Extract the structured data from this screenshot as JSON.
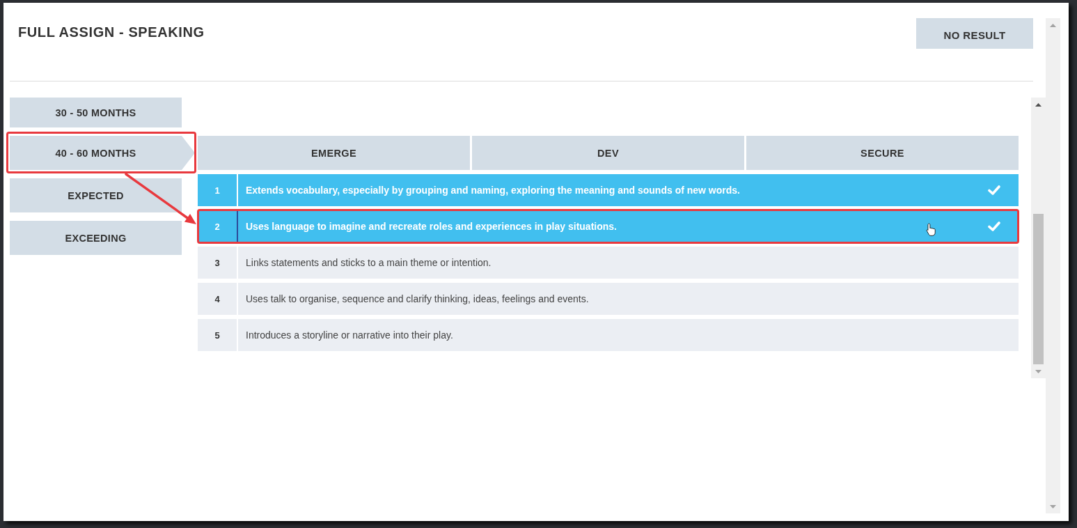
{
  "dialog": {
    "title": "FULL ASSIGN - SPEAKING",
    "action_button": "NO RESULT"
  },
  "tabs": [
    {
      "label": "30 - 50 MONTHS",
      "selected": false,
      "highlighted": false
    },
    {
      "label": "40 - 60 MONTHS",
      "selected": true,
      "highlighted": true
    },
    {
      "label": "EXPECTED",
      "selected": false,
      "highlighted": false
    },
    {
      "label": "EXCEEDING",
      "selected": false,
      "highlighted": false
    }
  ],
  "table": {
    "columns": [
      "EMERGE",
      "DEV",
      "SECURE"
    ],
    "rows": [
      {
        "number": "1",
        "text": "Extends vocabulary, especially by grouping and naming, exploring the meaning and sounds of new words.",
        "selected": true,
        "hovered": false,
        "highlighted": false
      },
      {
        "number": "2",
        "text": "Uses language to imagine and recreate roles and experiences in play situations.",
        "selected": true,
        "hovered": true,
        "highlighted": true
      },
      {
        "number": "3",
        "text": "Links statements and sticks to a main theme or intention.",
        "selected": false,
        "hovered": false,
        "highlighted": false
      },
      {
        "number": "4",
        "text": "Uses talk to organise, sequence and clarify thinking, ideas, feelings and events.",
        "selected": false,
        "hovered": false,
        "highlighted": false
      },
      {
        "number": "5",
        "text": "Introduces a storyline or narrative into their play.",
        "selected": false,
        "hovered": false,
        "highlighted": false
      }
    ]
  }
}
